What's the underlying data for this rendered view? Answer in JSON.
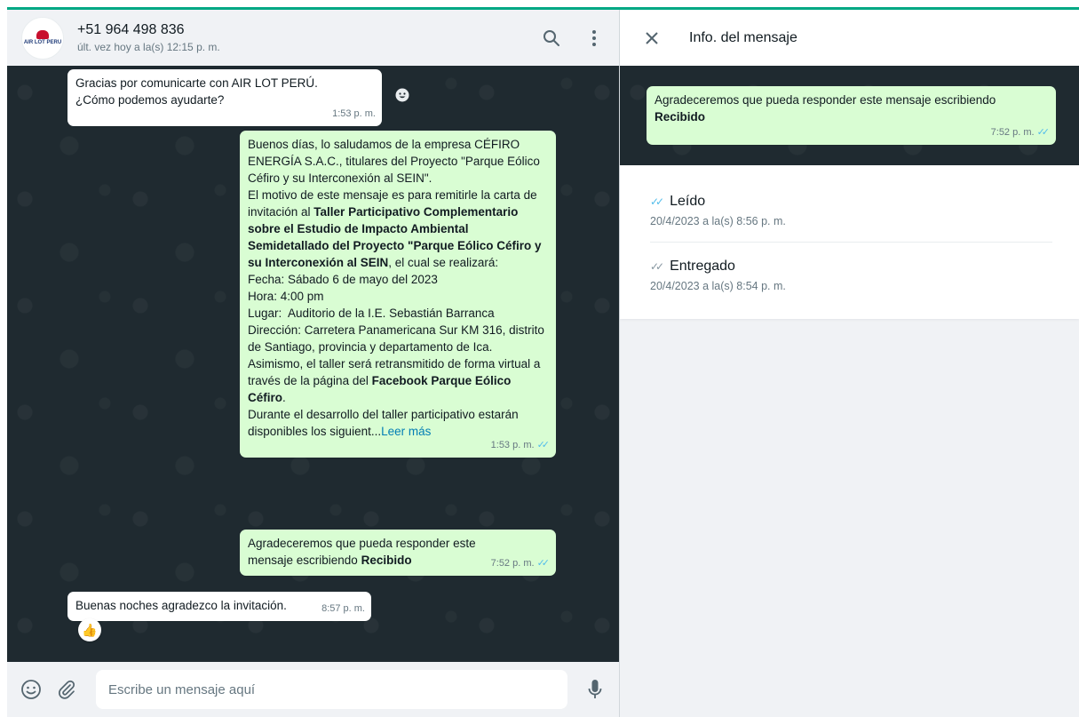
{
  "header": {
    "avatar_text": "AIR LOT PERU",
    "contact_name": "+51 964 498 836",
    "last_seen": "últ. vez hoy a la(s) 12:15 p. m."
  },
  "messages": [
    {
      "id": "welcome",
      "direction": "in",
      "lines": [
        "Gracias por comunicarte con AIR LOT PERÚ.",
        "¿Cómo podemos ayudarte?"
      ],
      "time": "1:53 p. m."
    },
    {
      "id": "invitation",
      "direction": "out",
      "p1": "Buenos días, lo saludamos de la empresa CÉFIRO ENERGÍA S.A.C., titulares del Proyecto \"Parque Eólico Céfiro y su Interconexión al SEIN\".",
      "p2_pre": "El motivo de este mensaje es para remitirle la carta de invitación al ",
      "p2_bold": "Taller Participativo Complementario sobre el Estudio de Impacto Ambiental Semidetallado del Proyecto \"Parque Eólico Céfiro y su Interconexión al SEIN",
      "p2_post": ", el cual se realizará:",
      "fecha": "Fecha: Sábado 6 de mayo del 2023",
      "hora": "Hora: 4:00 pm",
      "lugar": "Lugar:  Auditorio de la I.E. Sebastián Barranca",
      "direccion": "Dirección: Carretera Panamericana Sur KM 316, distrito de Santiago, provincia y departamento de Ica.",
      "p3_pre": "Asimismo, el taller será retransmitido de forma virtual a través de la página del ",
      "p3_bold": "Facebook Parque Eólico Céfiro",
      "p3_post": ".",
      "p4": "Durante el desarrollo del taller participativo estarán disponibles los siguient...",
      "read_more": "Leer más",
      "time": "1:53 p. m."
    },
    {
      "id": "request",
      "direction": "out",
      "text_pre": "Agradeceremos que pueda responder este mensaje escribiendo ",
      "text_bold": "Recibido",
      "time": "7:52 p. m."
    },
    {
      "id": "reply",
      "direction": "in",
      "text": "Buenas noches agradezco la invitación.",
      "time": "8:57 p. m.",
      "reaction": "👍"
    }
  ],
  "composer": {
    "placeholder": "Escribe un mensaje aquí"
  },
  "info_panel": {
    "title": "Info. del mensaje",
    "preview": {
      "text_pre": "Agradeceremos que pueda responder este mensaje escribiendo ",
      "text_bold": "Recibido",
      "time": "7:52 p. m."
    },
    "read_label": "Leído",
    "read_date": "20/4/2023 a la(s) 8:56 p. m.",
    "delivered_label": "Entregado",
    "delivered_date": "20/4/2023 a la(s) 8:54 p. m."
  },
  "colors": {
    "accent": "#00a884",
    "outgoing_bubble": "#d9fdd3",
    "incoming_bubble": "#ffffff",
    "chat_background": "#1f2a30",
    "read_ticks": "#53bdeb",
    "link": "#027eb5"
  },
  "icons": [
    "search-icon",
    "menu-icon",
    "close-icon",
    "emoji-icon",
    "attach-icon",
    "mic-icon",
    "double-check-icon",
    "smiley-icon"
  ]
}
